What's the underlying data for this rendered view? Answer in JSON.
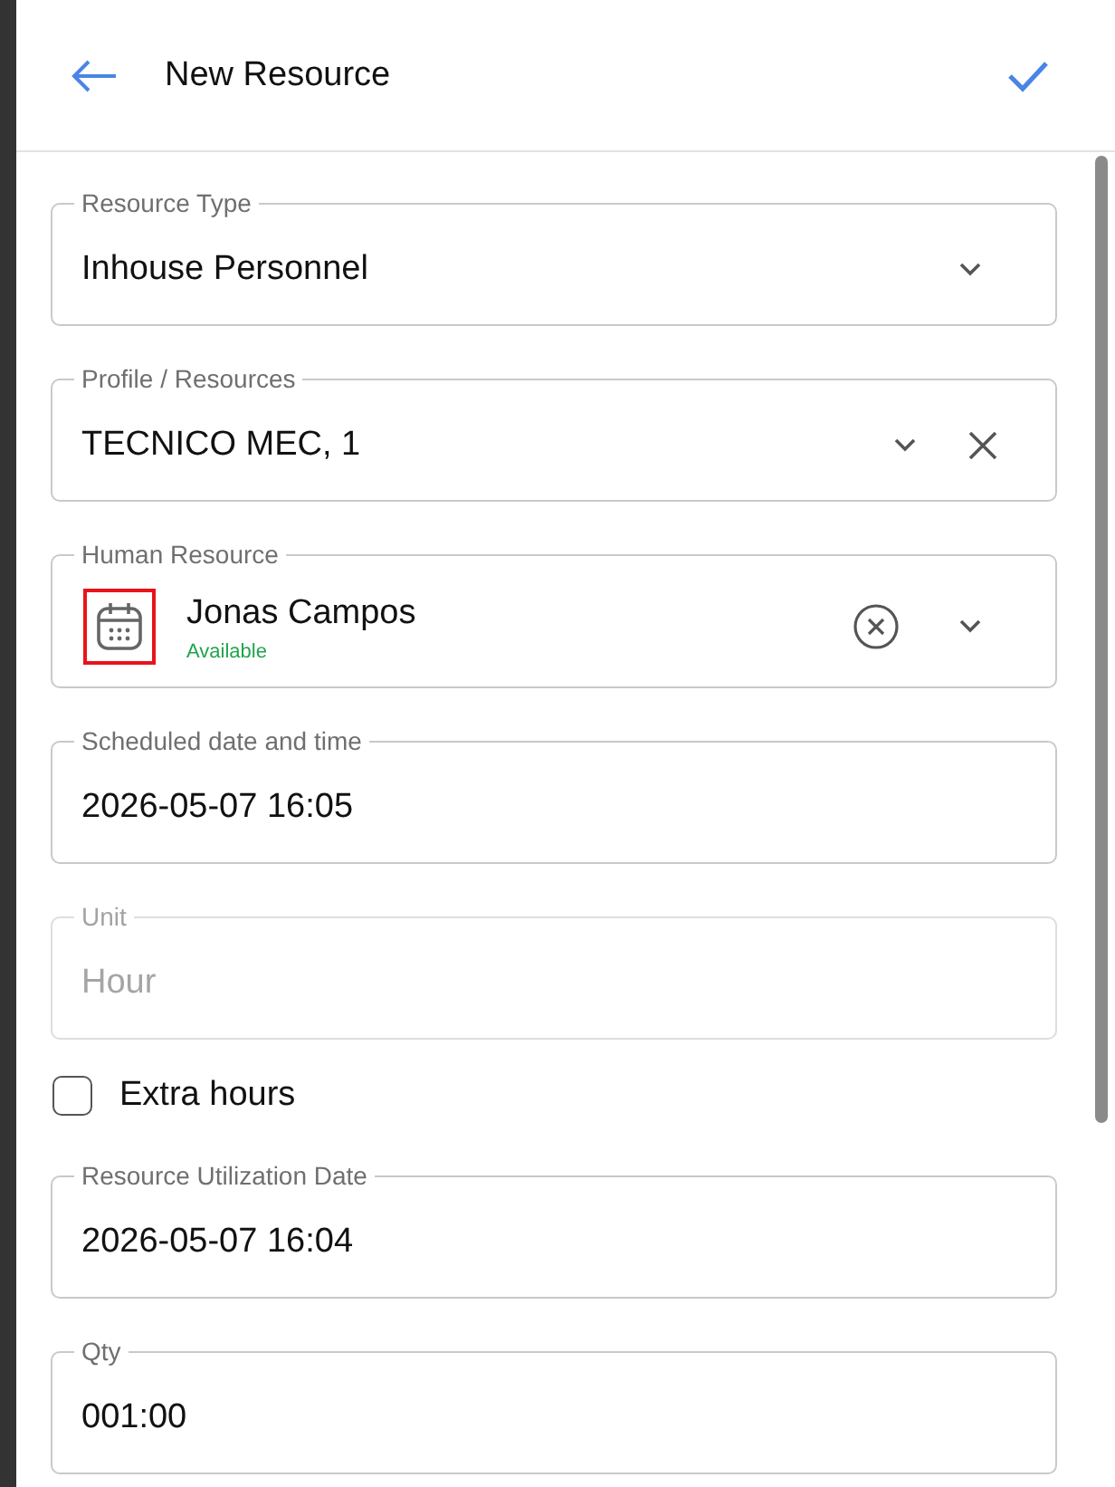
{
  "header": {
    "title": "New Resource"
  },
  "fields": [
    {
      "kind": "select",
      "label": "Resource Type",
      "value": "Inhouse Personnel",
      "clearable": false
    },
    {
      "kind": "select",
      "label": "Profile / Resources",
      "value": "TECNICO MEC, 1",
      "clearable": true
    },
    {
      "kind": "person",
      "label": "Human Resource",
      "value": "Jonas Campos",
      "status": "Available",
      "highlighted": true
    },
    {
      "kind": "text",
      "label": "Scheduled date and time",
      "value": "2026-05-07 16:05",
      "disabled": false
    },
    {
      "kind": "text",
      "label": "Unit",
      "placeholder": "Hour",
      "disabled": true
    },
    {
      "kind": "checkbox",
      "label": "Extra hours",
      "checked": false
    },
    {
      "kind": "text",
      "label": "Resource Utilization Date",
      "value": "2026-05-07 16:04",
      "disabled": false
    },
    {
      "kind": "text",
      "label": "Qty",
      "value": "001:00",
      "disabled": false
    }
  ]
}
